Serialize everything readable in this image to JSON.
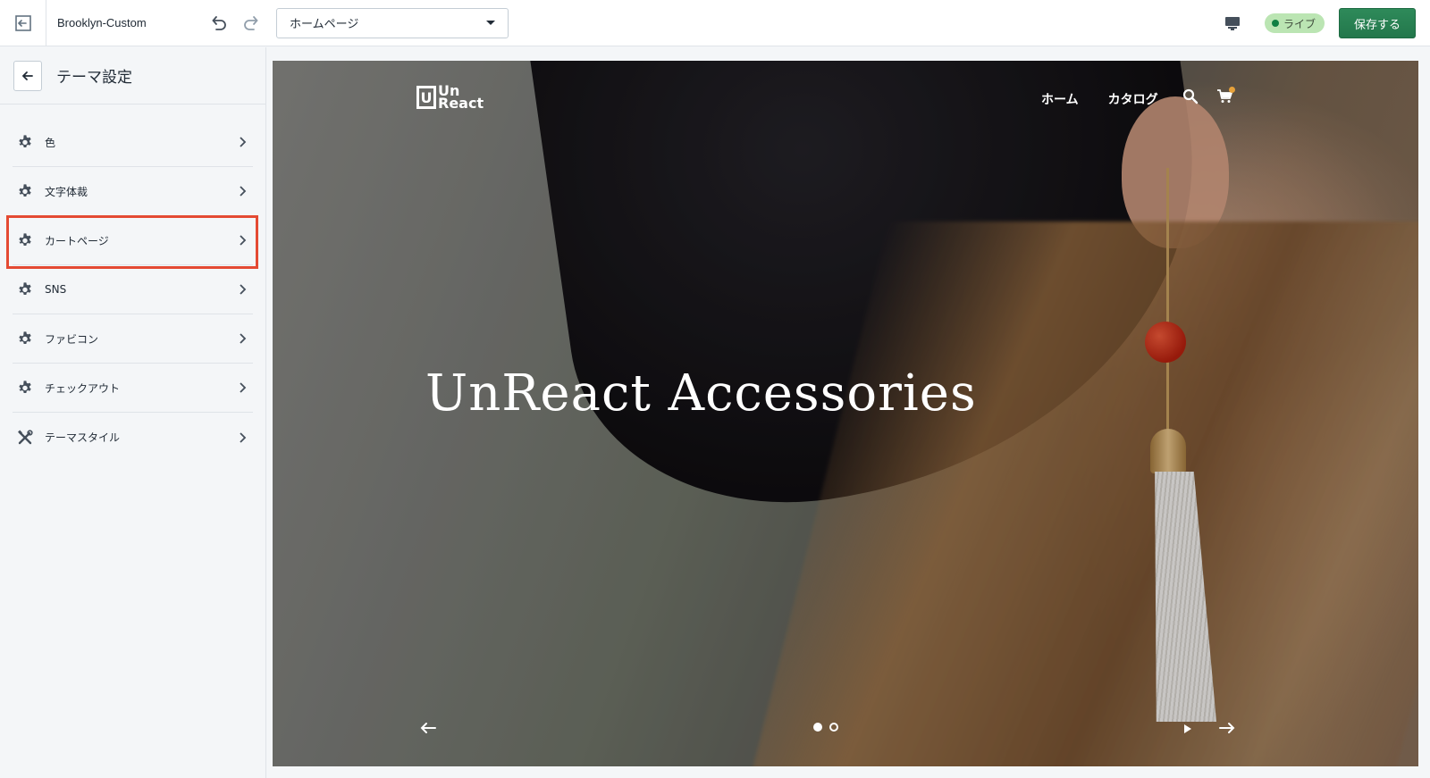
{
  "topbar": {
    "theme_name": "Brooklyn-Custom",
    "page_select": "ホームページ",
    "live_label": "ライブ",
    "save_label": "保存する"
  },
  "sidebar": {
    "title": "テーマ設定",
    "items": [
      {
        "label": "色",
        "icon": "gear-icon"
      },
      {
        "label": "文字体裁",
        "icon": "gear-icon"
      },
      {
        "label": "カートページ",
        "icon": "gear-icon",
        "highlighted": true
      },
      {
        "label": "SNS",
        "icon": "gear-icon"
      },
      {
        "label": "ファビコン",
        "icon": "gear-icon"
      },
      {
        "label": "チェックアウト",
        "icon": "gear-icon"
      },
      {
        "label": "テーマスタイル",
        "icon": "tools-icon"
      }
    ]
  },
  "preview": {
    "logo_line1": "Un",
    "logo_line2": "React",
    "logo_box": "U",
    "nav": [
      "ホーム",
      "カタログ"
    ],
    "hero_title": "UnReact Accessories",
    "slides_total": 2,
    "slide_active": 1
  },
  "colors": {
    "save_button": "#23774b",
    "live_badge": "#bbe5b3",
    "highlight_border": "#e44a33"
  }
}
